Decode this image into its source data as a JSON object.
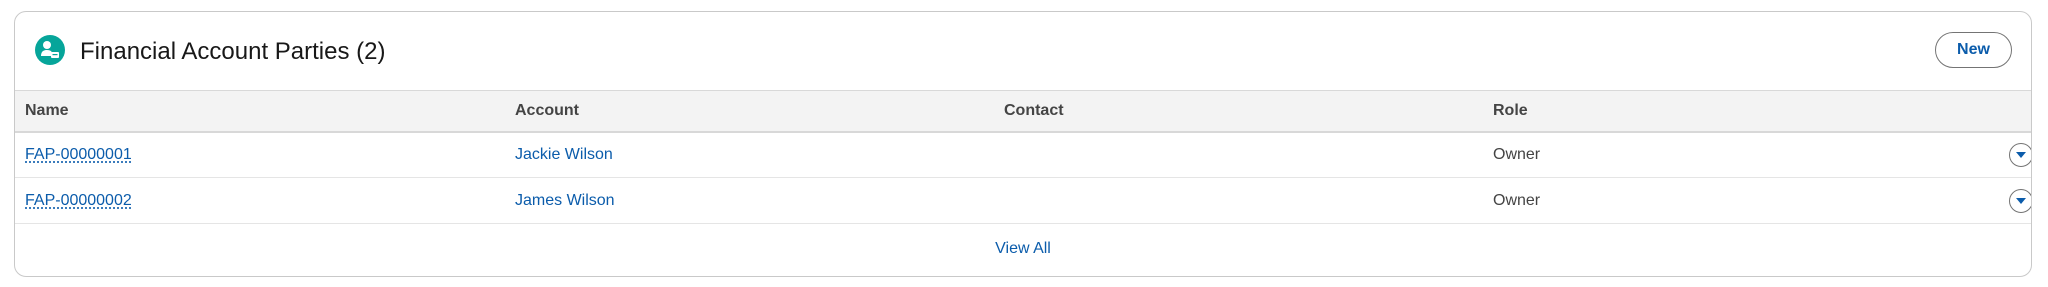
{
  "card": {
    "title": "Financial Account Parties (2)",
    "icon": "financial-account-party-icon",
    "new_button_label": "New",
    "accent_color": "#06a59a"
  },
  "table": {
    "columns": [
      "Name",
      "Account",
      "Contact",
      "Role"
    ],
    "rows": [
      {
        "name": "FAP-00000001",
        "account": "Jackie Wilson",
        "contact": "",
        "role": "Owner"
      },
      {
        "name": "FAP-00000002",
        "account": "James Wilson",
        "contact": "",
        "role": "Owner"
      }
    ]
  },
  "footer": {
    "view_all_label": "View All"
  },
  "colors": {
    "link": "#0b5cab",
    "header_bg": "#f3f3f3",
    "border": "#c9c9c9"
  }
}
